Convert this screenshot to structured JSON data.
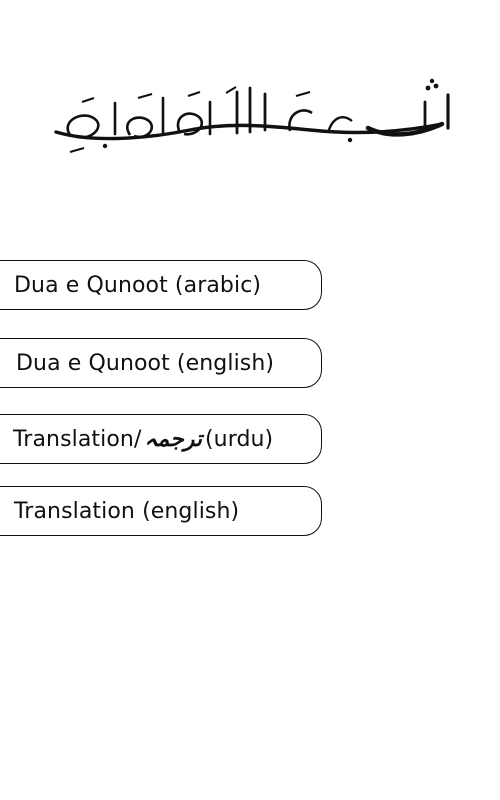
{
  "header": {
    "calligraphy": "بسم الله الرحمن الرحيم"
  },
  "menu": {
    "items": [
      {
        "label": "Dua e Qunoot (arabic)"
      },
      {
        "label": "Dua e Qunoot (english)"
      },
      {
        "label_prefix": "Translation/",
        "label_urdu": "ترجمہ",
        "label_suffix": "(urdu)"
      },
      {
        "label": "Translation (english)"
      }
    ]
  }
}
